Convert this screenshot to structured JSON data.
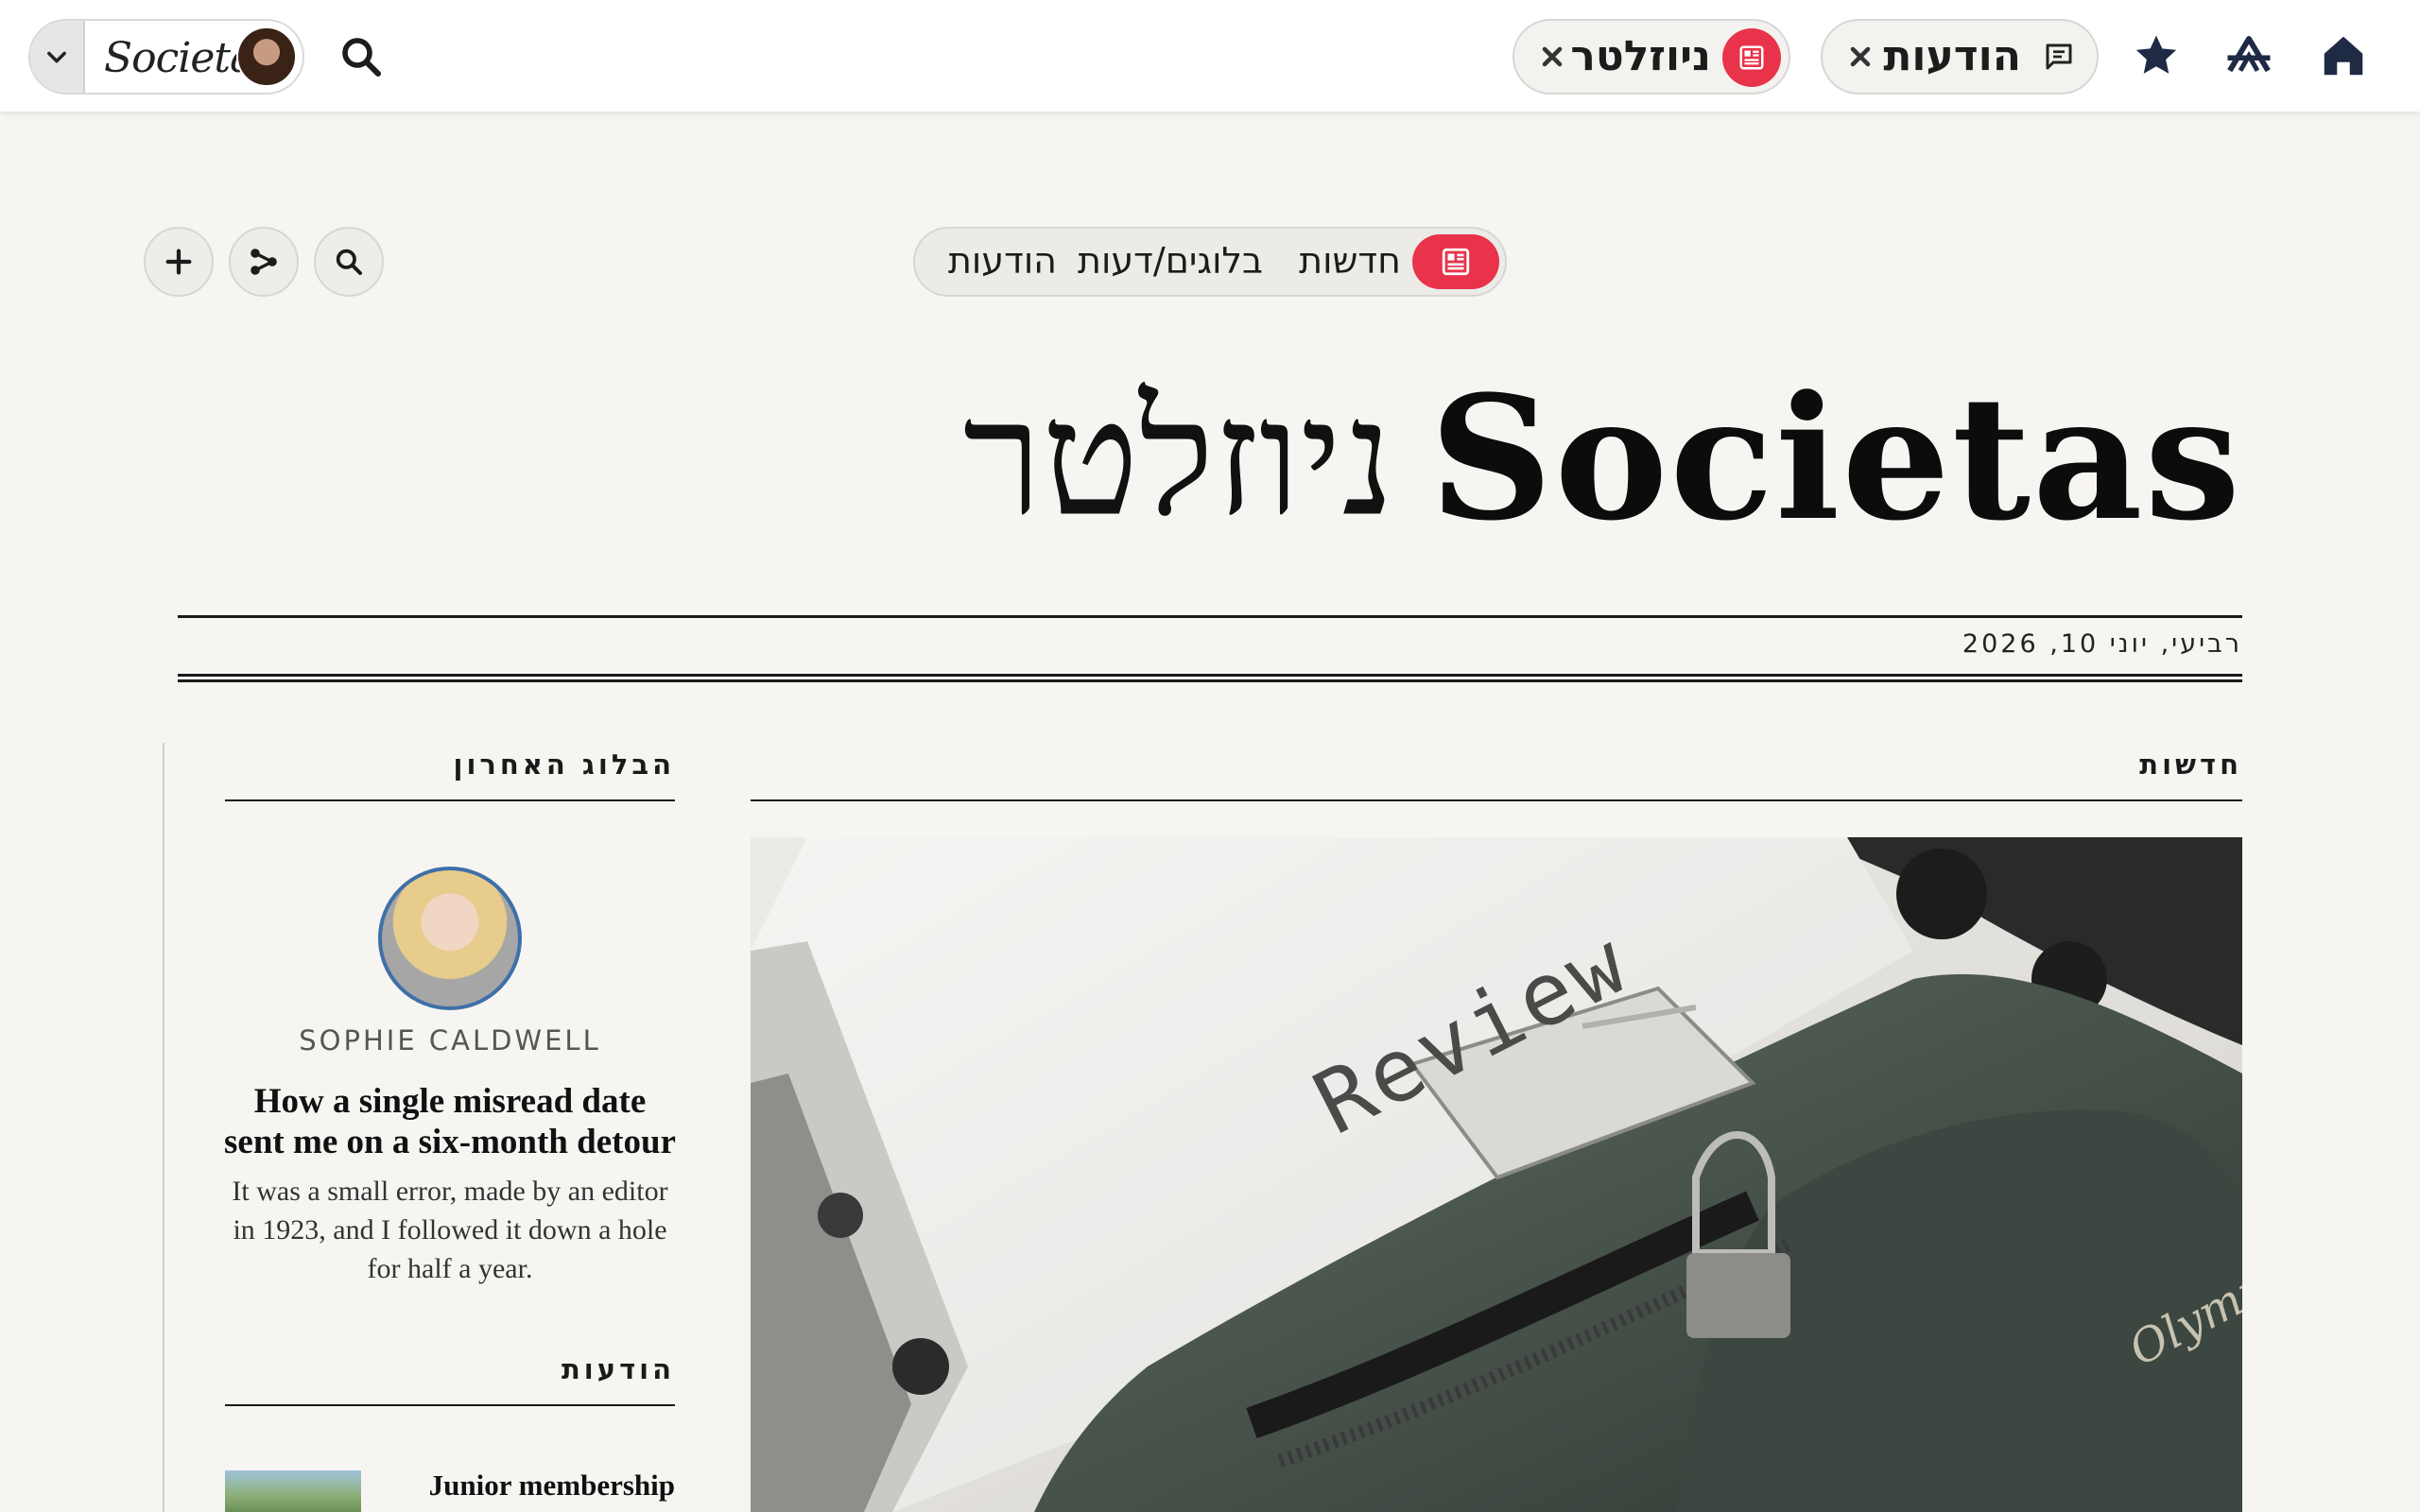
{
  "topbar": {
    "brand_logo": "Societas",
    "tabs": [
      {
        "label": "ניוזלטר",
        "icon": "newsletter-icon",
        "close": "close-icon"
      },
      {
        "label": "הודעות",
        "icon": "message-icon",
        "close": "close-icon"
      }
    ],
    "icons": [
      "chevron-down-icon",
      "search-icon",
      "star-icon",
      "app-logo-icon",
      "home-icon"
    ]
  },
  "toolbar": {
    "sections": [
      {
        "label": "חדשות",
        "icon": "newsletter-icon",
        "active": true
      },
      {
        "label": "בלוגים/דעות"
      },
      {
        "label": "הודעות"
      }
    ],
    "buttons": [
      "search-icon",
      "share-icon",
      "add-icon"
    ]
  },
  "masthead": {
    "latin": "Societas",
    "hebrew": "ניוזלטר",
    "date": "רביעי, יוני 10, 2026"
  },
  "news": {
    "heading": "חדשות",
    "image_text": "Review"
  },
  "sidebar": {
    "blog_heading": "הבלוג האחרון",
    "author": "SOPHIE CALDWELL",
    "title": "How a single misread date sent me on a six-month detour",
    "excerpt": "It was a small error, made by an editor in 1923, and I followed it down a hole for half a year.",
    "notices_heading": "הודעות",
    "notice_title": "Junior membership"
  },
  "colors": {
    "accent": "#e8334a",
    "background": "#f7f5f2",
    "avatar_ring": "#3f6fa8"
  }
}
